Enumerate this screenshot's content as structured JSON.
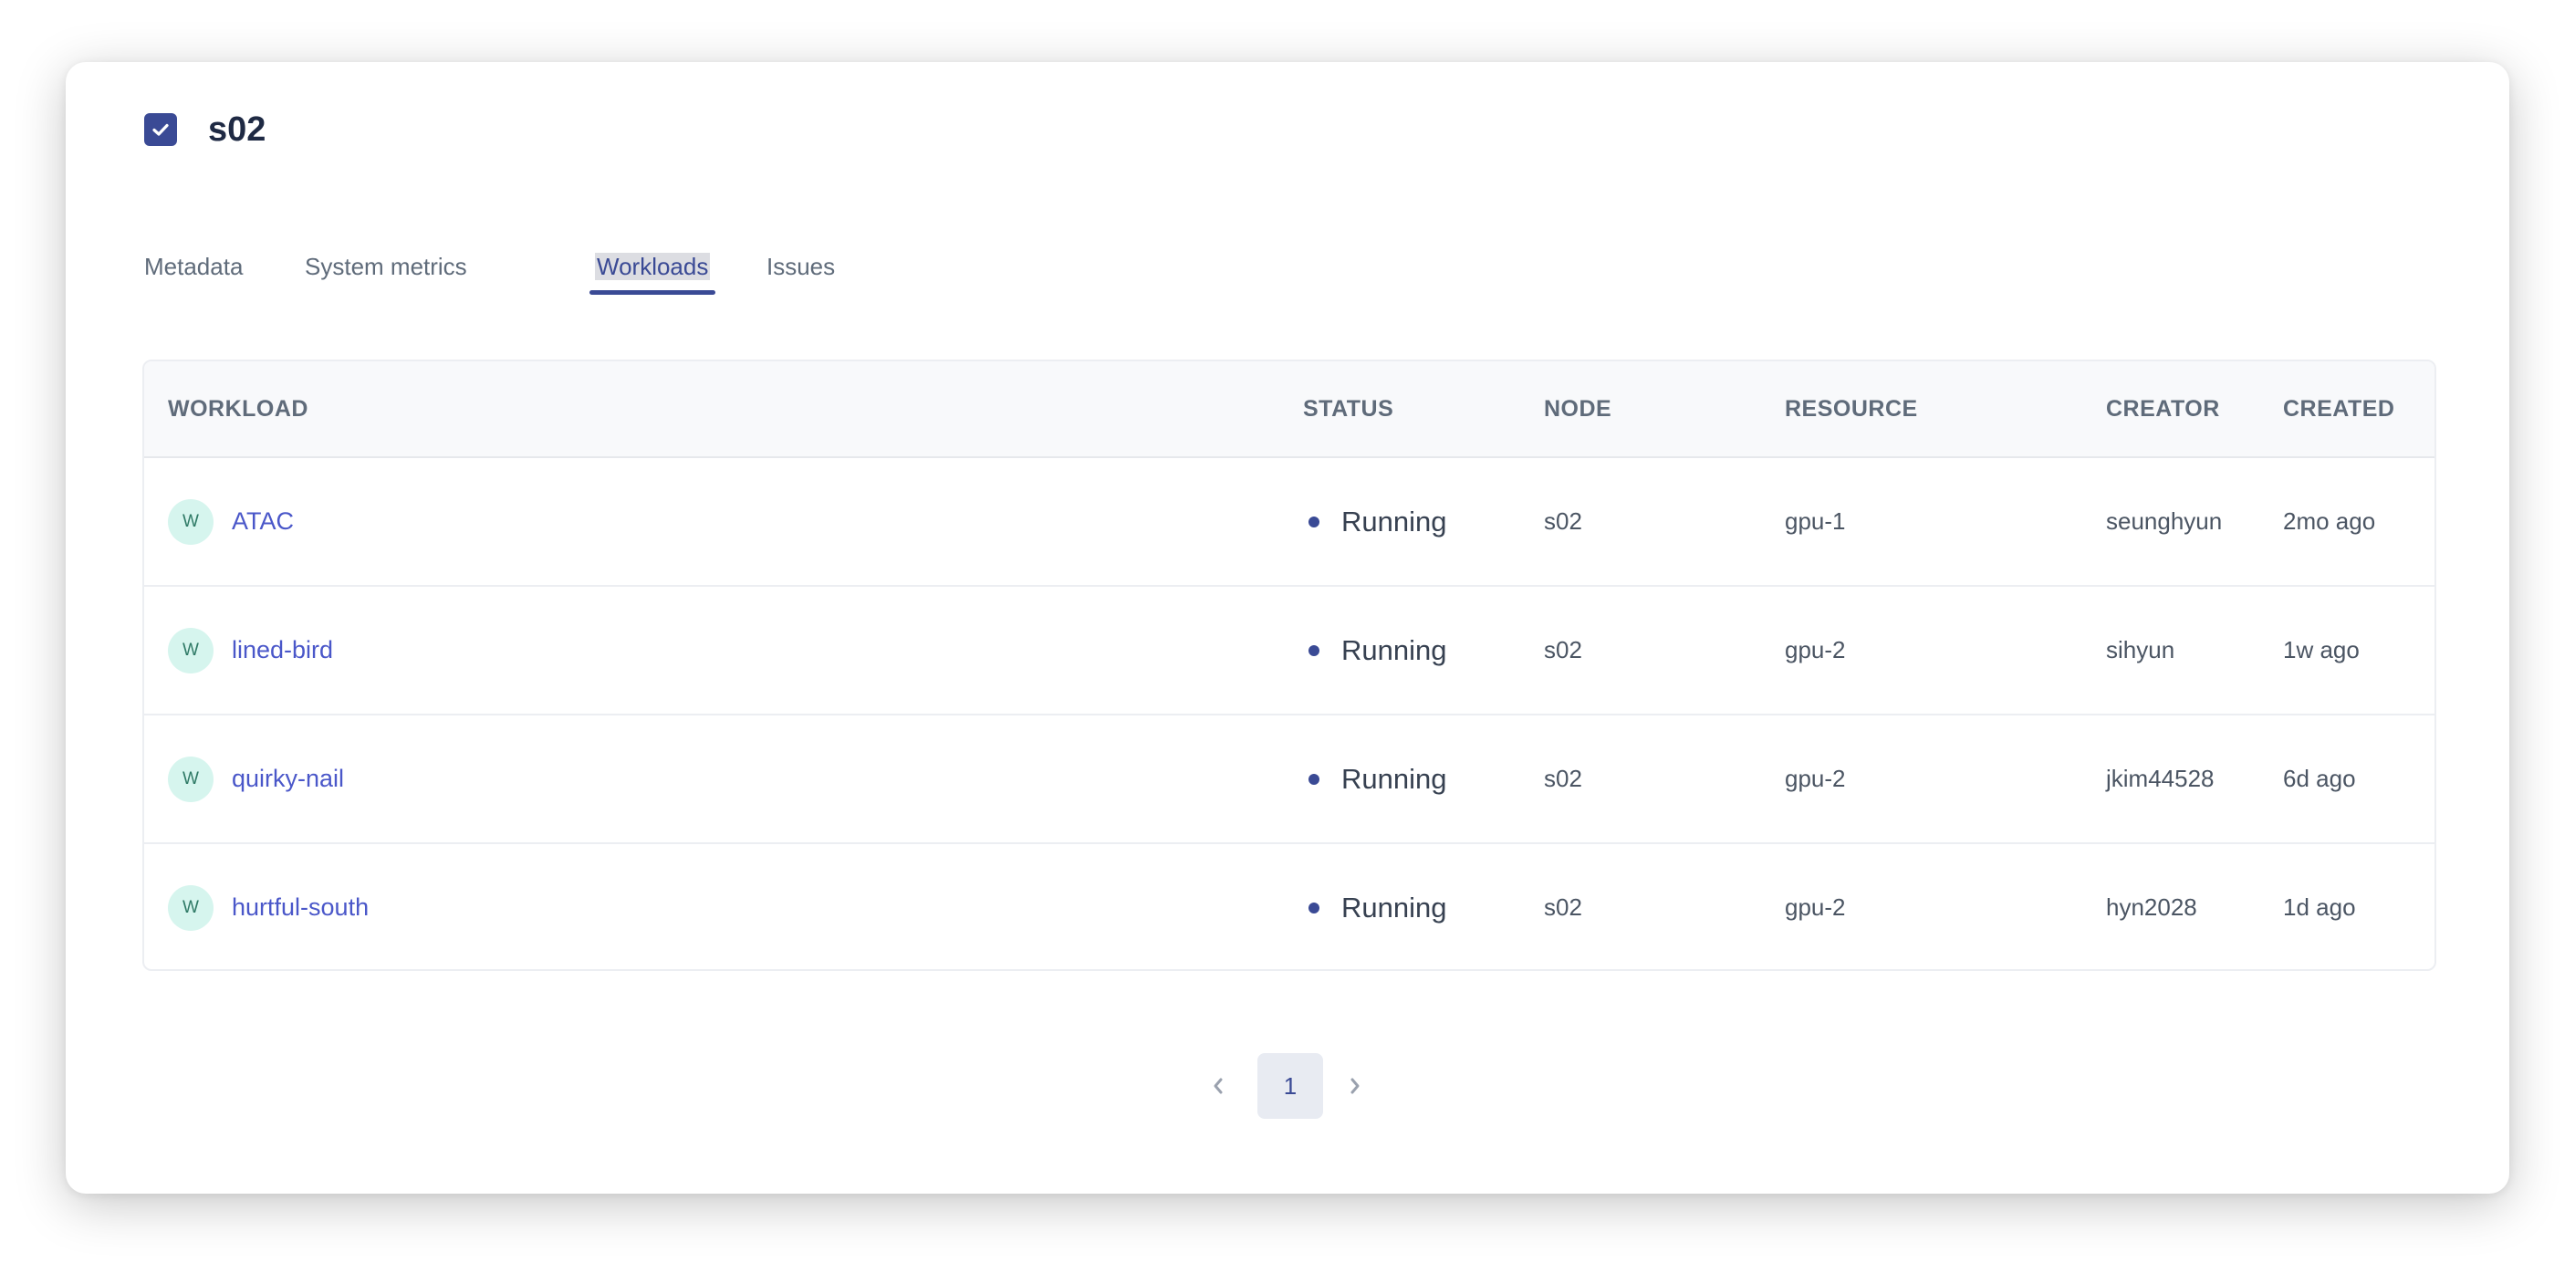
{
  "header": {
    "title": "s02",
    "checked": true
  },
  "tabs": [
    {
      "label": "Metadata",
      "active": false
    },
    {
      "label": "System metrics",
      "active": false
    },
    {
      "label": "Workloads",
      "active": true
    },
    {
      "label": "Issues",
      "active": false
    }
  ],
  "table": {
    "columns": {
      "workload": "WORKLOAD",
      "status": "STATUS",
      "node": "NODE",
      "resource": "RESOURCE",
      "creator": "CREATOR",
      "created": "CREATED"
    },
    "rows": [
      {
        "avatar": "W",
        "workload": "ATAC",
        "status": "Running",
        "node": "s02",
        "resource": "gpu-1",
        "creator": "seunghyun",
        "created": "2mo ago"
      },
      {
        "avatar": "W",
        "workload": "lined-bird",
        "status": "Running",
        "node": "s02",
        "resource": "gpu-2",
        "creator": "sihyun",
        "created": "1w ago"
      },
      {
        "avatar": "W",
        "workload": "quirky-nail",
        "status": "Running",
        "node": "s02",
        "resource": "gpu-2",
        "creator": "jkim44528",
        "created": "6d ago"
      },
      {
        "avatar": "W",
        "workload": "hurtful-south",
        "status": "Running",
        "node": "s02",
        "resource": "gpu-2",
        "creator": "hyn2028",
        "created": "1d ago"
      }
    ]
  },
  "pagination": {
    "current_page": "1",
    "prev_icon": "chevron-left-icon",
    "next_icon": "chevron-right-icon"
  },
  "colors": {
    "accent": "#3a4a95",
    "link": "#4a57c9",
    "avatar_bg": "#d6f5ee",
    "avatar_text": "#2f7a66",
    "status_running": "#3a4a95"
  }
}
